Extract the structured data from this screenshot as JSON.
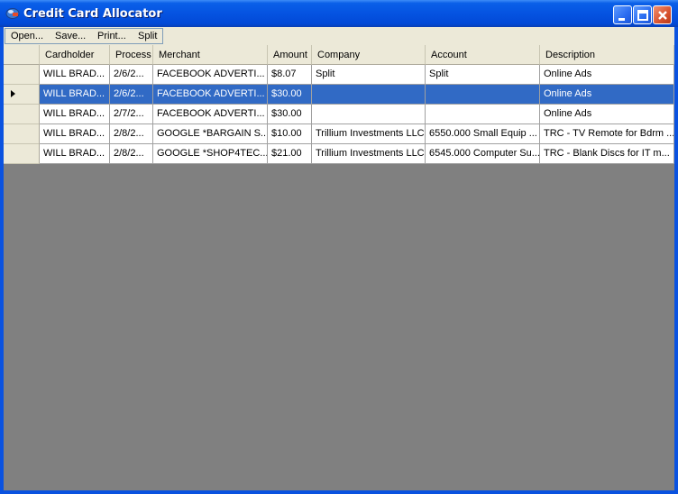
{
  "window": {
    "title": "Credit Card Allocator"
  },
  "menu": {
    "items": [
      "Open...",
      "Save...",
      "Print...",
      "Split"
    ]
  },
  "grid": {
    "columns": [
      "Cardholder",
      "Process",
      "Merchant",
      "Amount",
      "Company",
      "Account",
      "Description"
    ],
    "selected_row": 1,
    "rows": [
      [
        "WILL BRAD...",
        "2/6/2...",
        "FACEBOOK ADVERTI...",
        "$8.07",
        "Split",
        "Split",
        "Online Ads"
      ],
      [
        "WILL BRAD...",
        "2/6/2...",
        "FACEBOOK ADVERTI...",
        "$30.00",
        "",
        "",
        "Online Ads"
      ],
      [
        "WILL BRAD...",
        "2/7/2...",
        "FACEBOOK ADVERTI...",
        "$30.00",
        "",
        "",
        "Online Ads"
      ],
      [
        "WILL BRAD...",
        "2/8/2...",
        "GOOGLE *BARGAIN S...",
        "$10.00",
        "Trillium Investments LLC",
        "6550.000 Small Equip ...",
        "TRC - TV Remote for Bdrm ..."
      ],
      [
        "WILL BRAD...",
        "2/8/2...",
        "GOOGLE *SHOP4TEC...",
        "$21.00",
        "Trillium Investments LLC",
        "6545.000 Computer Su...",
        "TRC -  Blank Discs for IT m..."
      ]
    ]
  },
  "colors": {
    "title_bar": "#0553e1",
    "selection": "#316ac5",
    "empty_area": "#808080"
  }
}
